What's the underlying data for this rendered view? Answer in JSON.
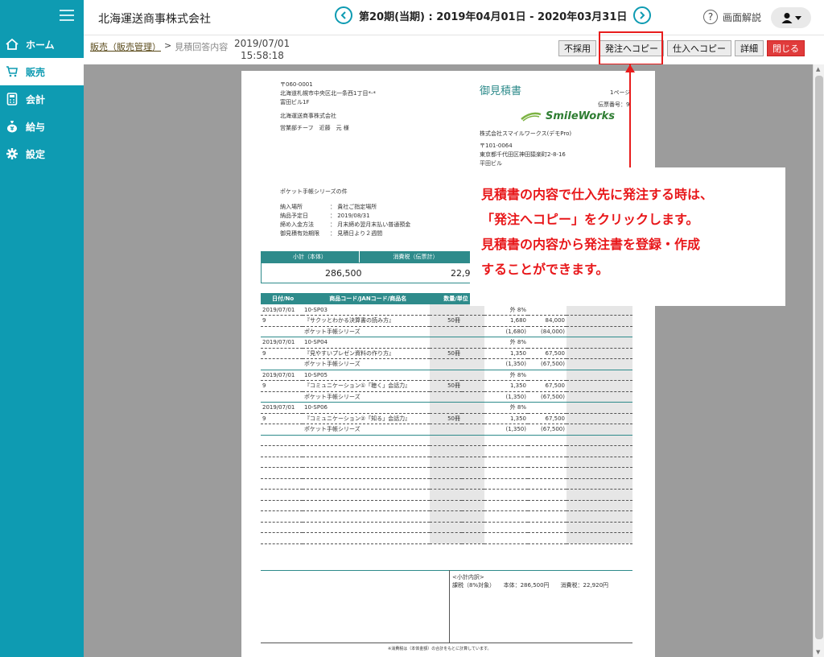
{
  "company": "北海運送商事株式会社",
  "period": "第20期(当期) : 2019年04月01日 - 2020年03月31日",
  "help_label": "画面解説",
  "sidebar": {
    "items": [
      {
        "label": "ホーム"
      },
      {
        "label": "販売"
      },
      {
        "label": "会計"
      },
      {
        "label": "給与"
      },
      {
        "label": "設定"
      }
    ]
  },
  "breadcrumb": {
    "link": "販売（販売管理）",
    "sep": ">",
    "current": "見積回答内容"
  },
  "datetime": {
    "date": "2019/07/01",
    "time": "15:58:18"
  },
  "actions": {
    "reject": "不採用",
    "copy_to_order": "発注へコピー",
    "copy_to_purchase": "仕入へコピー",
    "detail": "詳細",
    "close": "閉じる"
  },
  "callout": {
    "lines": [
      "見積書の内容で仕入先に発注する時は、",
      "「発注へコピー」をクリックします。",
      "見積書の内容から発注書を登録・作成",
      "することができます。"
    ]
  },
  "doc": {
    "zip": "〒060-0001",
    "address": "北海道札幌市中央区北一条西1丁目*-*",
    "building": "富田ビル1F",
    "customer": "北海運送商事株式会社",
    "dept": "営業部チーフ　近藤　元 様",
    "title": "御見積書",
    "page": "1ページ",
    "slip_no": "伝票番号：9",
    "logo": "SmileWorks",
    "issuer": "株式会社スマイルワークス(デモPro)",
    "issuer_zip": "〒101-0064",
    "issuer_address": "東京都千代田区神田猿楽町2-8-16",
    "issuer_building": "平田ビル",
    "subject": "ポケット手帳シリーズの件",
    "terms": [
      {
        "k": "納入場所",
        "v": "：  貴社ご指定場所"
      },
      {
        "k": "納品予定日",
        "v": "：  2019/08/31"
      },
      {
        "k": "締め入金方法",
        "v": "：  月末締め翌月末払い普通預金"
      },
      {
        "k": "御見積有効期限",
        "v": "：  見積日より２週間"
      }
    ],
    "sum_head_subtotal": "小計（本体）",
    "sum_head_tax": "消費税（伝票計）",
    "subtotal": "286,500",
    "tax": "22,92",
    "col_date": "日付/No",
    "col_code": "商品コード/JANコード/商品名",
    "col_qty": "数量/単位",
    "rows": [
      {
        "a": "2019/07/01",
        "b": "10-SP03",
        "c": "",
        "d": "外 8%",
        "e": ""
      },
      {
        "a": "9",
        "b": "『サクッとわかる決算書の読み方』",
        "c": "50冊",
        "d": "1,680",
        "e": "84,000"
      },
      {
        "a": "",
        "b": "ポケット手帳シリーズ",
        "c": "",
        "d": "(1,680)",
        "e": "(84,000)"
      },
      {
        "a": "2019/07/01",
        "b": "10-SP04",
        "c": "",
        "d": "外 8%",
        "e": ""
      },
      {
        "a": "9",
        "b": "『見やすいプレゼン資料の作り方』",
        "c": "50冊",
        "d": "1,350",
        "e": "67,500"
      },
      {
        "a": "",
        "b": "ポケット手帳シリーズ",
        "c": "",
        "d": "(1,350)",
        "e": "(67,500)"
      },
      {
        "a": "2019/07/01",
        "b": "10-SP05",
        "c": "",
        "d": "外 8%",
        "e": ""
      },
      {
        "a": "9",
        "b": "『コミュニケーション①「聴く」会話力』",
        "c": "50冊",
        "d": "1,350",
        "e": "67,500"
      },
      {
        "a": "",
        "b": "ポケット手帳シリーズ",
        "c": "",
        "d": "(1,350)",
        "e": "(67,500)"
      },
      {
        "a": "2019/07/01",
        "b": "10-SP06",
        "c": "",
        "d": "外 8%",
        "e": ""
      },
      {
        "a": "9",
        "b": "『コミュニケーション②「知る」会話力』",
        "c": "50冊",
        "d": "1,350",
        "e": "67,500"
      },
      {
        "a": "",
        "b": "ポケット手帳シリーズ",
        "c": "",
        "d": "(1,350)",
        "e": "(67,500)"
      }
    ],
    "breakdown_title": "<小計内訳>",
    "breakdown_text": "課税（8%対象）　　本体：286,500円　　消費税：22,920円",
    "footnote": "※消費税は（本体金額）の合計をもとに計算しています。"
  }
}
